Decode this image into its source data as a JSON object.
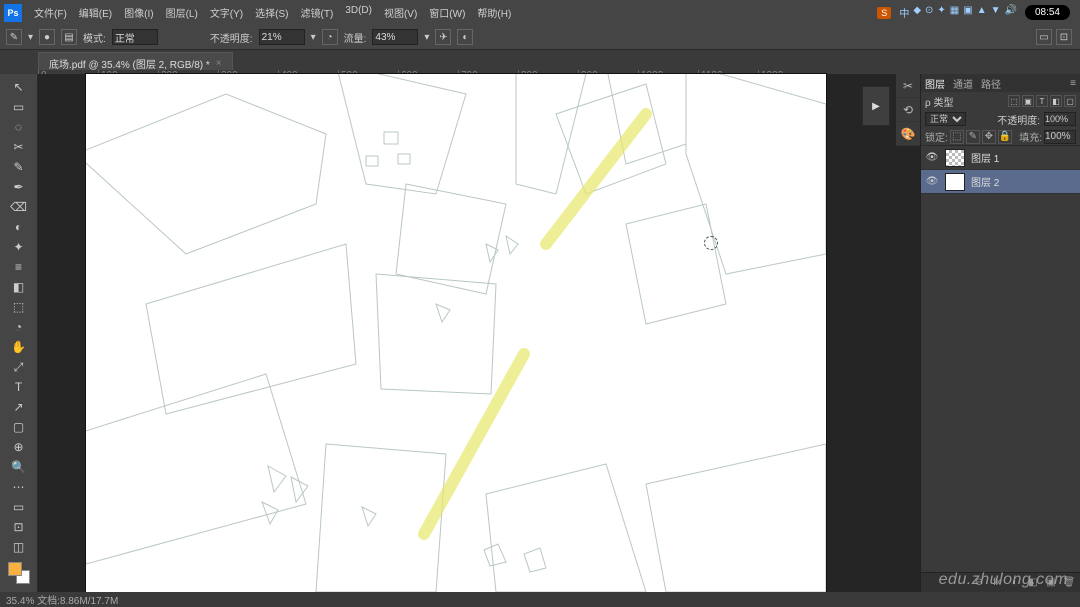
{
  "menu": [
    "文件(F)",
    "编辑(E)",
    "图像(I)",
    "图层(L)",
    "文字(Y)",
    "选择(S)",
    "滤镜(T)",
    "3D(D)",
    "视图(V)",
    "窗口(W)",
    "帮助(H)"
  ],
  "tray": {
    "time": "08:54",
    "badge": "S",
    "icons": [
      "中",
      "◆",
      "⊙",
      "✦",
      "▦",
      "▣",
      "▲",
      "▼",
      "🔊"
    ]
  },
  "options": {
    "mode_label": "模式:",
    "mode_value": "正常",
    "opacity_label": "不透明度:",
    "opacity_value": "21%",
    "flow_label": "流量:",
    "flow_value": "43%"
  },
  "tab": {
    "title": "底场.pdf @ 35.4% (图层 2, RGB/8) *"
  },
  "tools": [
    "↖",
    "▭",
    "◌",
    "✂",
    "✎",
    "✒",
    "⌫",
    "◐",
    "✦",
    "≡",
    "◧",
    "⬚",
    "◔",
    "✋",
    "⤢",
    "T",
    "↗",
    "▢",
    "⊕",
    "🔍",
    "⋯",
    "▭",
    "⊡",
    "◫"
  ],
  "side_icons": [
    "✂",
    "⟲",
    "🎨"
  ],
  "quick": "▶",
  "panel": {
    "tabs": [
      "图层",
      "通道",
      "路径"
    ],
    "kind_label": "ρ 类型",
    "kind_opts": [
      "⬚",
      "▣",
      "T",
      "◧",
      "▢"
    ],
    "blend": "正常",
    "opacity_lbl": "不透明度:",
    "opacity": "100%",
    "lock_lbl": "锁定:",
    "locks": [
      "⬚",
      "✎",
      "✥",
      "🔒"
    ],
    "fill_lbl": "填充:",
    "fill": "100%",
    "layers": [
      {
        "name": "图层 1",
        "chk": true
      },
      {
        "name": "图层 2",
        "chk": false
      }
    ],
    "foot": [
      "⊖",
      "fx",
      "◐",
      "◧",
      "▣",
      "🗑"
    ]
  },
  "ruler_marks": [
    "0",
    "100",
    "200",
    "300",
    "400",
    "500",
    "600",
    "700",
    "800",
    "900",
    "1000",
    "1100",
    "1200"
  ],
  "status": "35.4%    文档:8.86M/17.7M",
  "watermark": "edu.zhulong.com"
}
